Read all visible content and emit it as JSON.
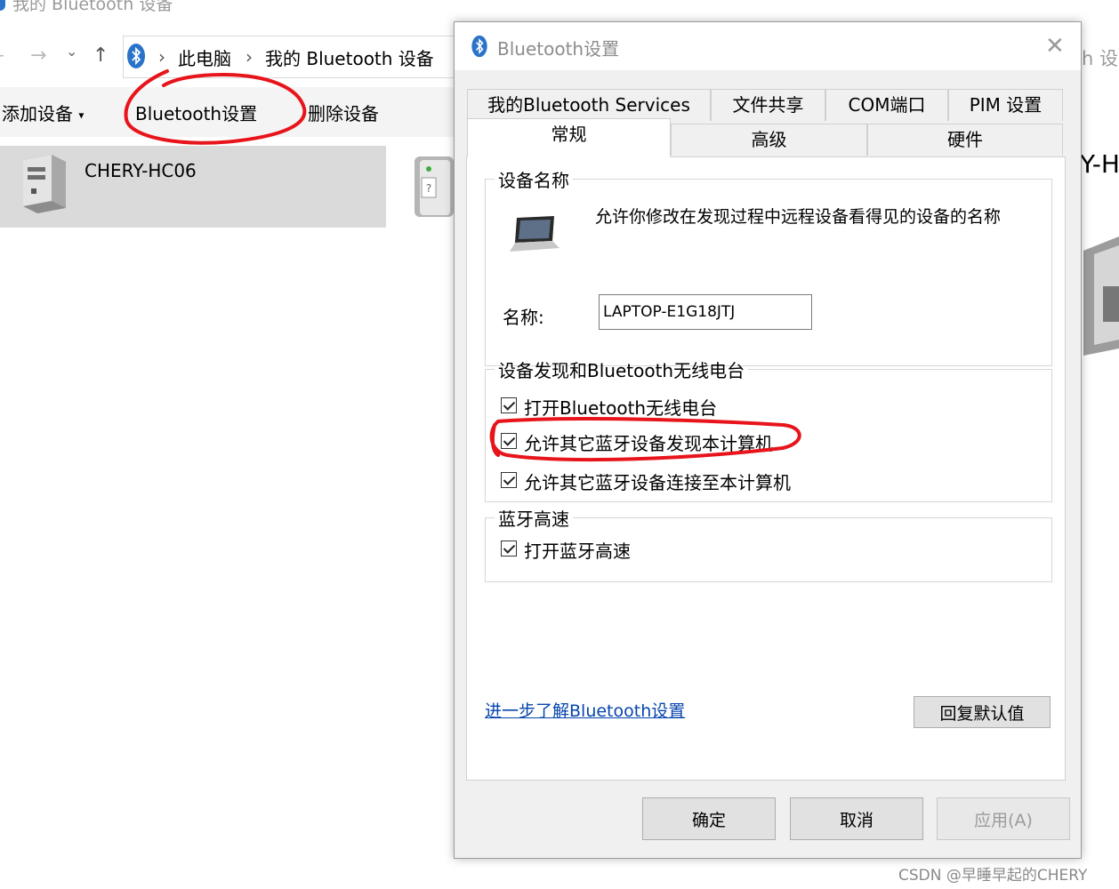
{
  "explorer": {
    "window_title": "我的 Bluetooth 设备",
    "breadcrumb": [
      "此电脑",
      "我的 Bluetooth 设备"
    ],
    "toolbar": {
      "add_device": "添加设备",
      "bluetooth_settings": "Bluetooth设置",
      "remove_device": "删除设备"
    },
    "device_name": "CHERY-HC06",
    "right_fragment_title": "h 设",
    "right_fragment_device": "Y-H"
  },
  "dialog": {
    "title": "Bluetooth设置",
    "tabs_row1": [
      "我的Bluetooth Services",
      "文件共享",
      "COM端口",
      "PIM 设置"
    ],
    "tabs_row2": [
      "常规",
      "高级",
      "硬件"
    ],
    "active_tab": "常规",
    "device_name_group": {
      "legend": "设备名称",
      "description": "允许你修改在发现过程中远程设备看得见的设备的名称",
      "name_label": "名称:",
      "name_value": "LAPTOP-E1G18JTJ"
    },
    "discovery_group": {
      "legend": "设备发现和Bluetooth无线电台",
      "options": [
        {
          "label": "打开Bluetooth无线电台",
          "checked": true
        },
        {
          "label": "允许其它蓝牙设备发现本计算机",
          "checked": true
        },
        {
          "label": "允许其它蓝牙设备连接至本计算机",
          "checked": true
        }
      ]
    },
    "highspeed_group": {
      "legend": "蓝牙高速",
      "options": [
        {
          "label": "打开蓝牙高速",
          "checked": true
        }
      ]
    },
    "learn_more_link": "进一步了解Bluetooth设置",
    "restore_defaults": "回复默认值",
    "buttons": {
      "ok": "确定",
      "cancel": "取消",
      "apply": "应用(A)"
    }
  },
  "watermark": "CSDN @早睡早起的CHERY",
  "colors": {
    "annotation_red": "#e8141b",
    "link_blue": "#0645ad",
    "bluetooth_blue": "#2b73c9"
  }
}
